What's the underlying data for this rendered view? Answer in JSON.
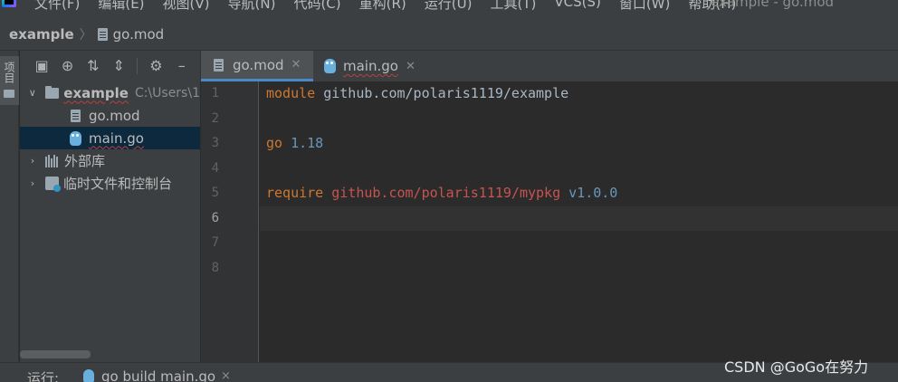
{
  "menubar": {
    "items": [
      "文件(F)",
      "编辑(E)",
      "视图(V)",
      "导航(N)",
      "代码(C)",
      "重构(R)",
      "运行(U)",
      "工具(T)",
      "VCS(S)",
      "窗口(W)",
      "帮助(H)"
    ],
    "window_title": "example - go.mod"
  },
  "navbar": {
    "project": "example",
    "file": "go.mod"
  },
  "left_strip": {
    "project_tab_label": "项目"
  },
  "project_tree": {
    "root": {
      "label": "example",
      "path": "C:\\Users\\1"
    },
    "files": [
      {
        "label": "go.mod",
        "icon": "file-icon"
      },
      {
        "label": "main.go",
        "icon": "gopher-icon"
      }
    ],
    "external_libraries": "外部库",
    "scratches": "临时文件和控制台"
  },
  "editor": {
    "tabs": [
      {
        "label": "go.mod",
        "active": true
      },
      {
        "label": "main.go",
        "active": false
      }
    ],
    "line_numbers": [
      "1",
      "2",
      "3",
      "4",
      "5",
      "6",
      "7",
      "8"
    ],
    "current_line": "6",
    "lines": {
      "l1_keyword": "module",
      "l1_path": "github.com/polaris1119/example",
      "l3_keyword": "go",
      "l3_version": "1.18",
      "l5_keyword": "require",
      "l5_dependency": "github.com/polaris1119/mypkg",
      "l5_version": "v1.0.0"
    }
  },
  "run_bar": {
    "label": "运行:",
    "config": "go build main.go",
    "close": "×"
  },
  "watermark": "CSDN @GoGo在努力",
  "colors": {
    "keyword": "#cc7832",
    "number": "#6897bb",
    "error_path": "#c75450",
    "selection": "#0d293e",
    "active_tab_underline": "#4a88c7"
  }
}
